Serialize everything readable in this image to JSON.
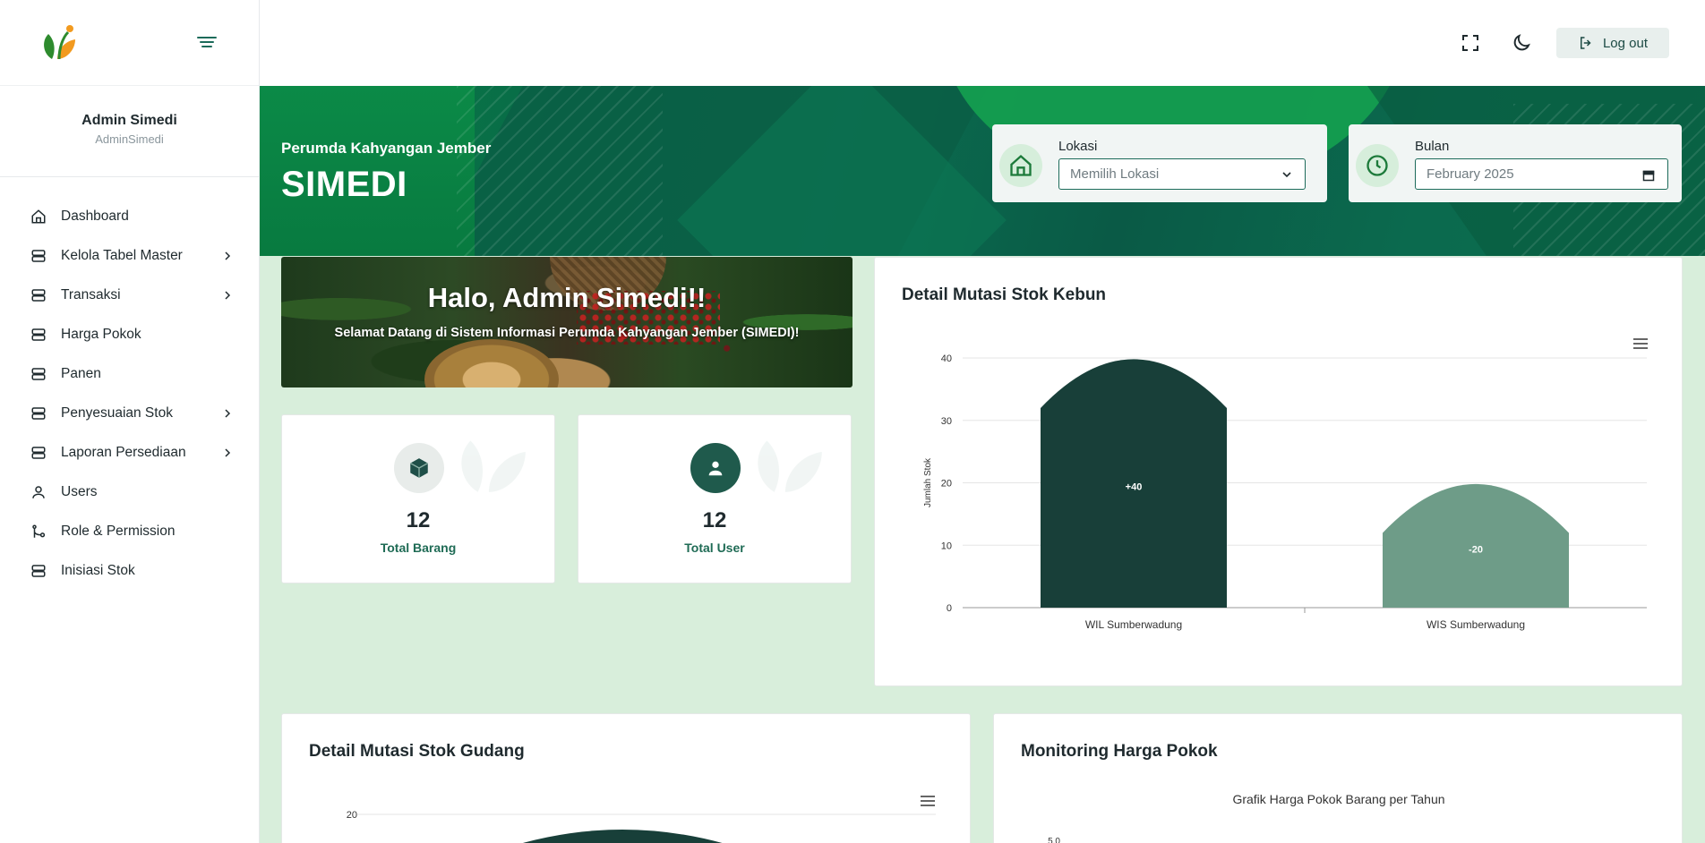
{
  "sidebar": {
    "profile": {
      "name": "Admin Simedi",
      "username": "AdminSimedi"
    },
    "items": [
      {
        "label": "Dashboard",
        "icon": "home-icon",
        "has_children": false
      },
      {
        "label": "Kelola Tabel Master",
        "icon": "server-icon",
        "has_children": true
      },
      {
        "label": "Transaksi",
        "icon": "server-icon",
        "has_children": true
      },
      {
        "label": "Harga Pokok",
        "icon": "server-icon",
        "has_children": false
      },
      {
        "label": "Panen",
        "icon": "server-icon",
        "has_children": false
      },
      {
        "label": "Penyesuaian Stok",
        "icon": "server-icon",
        "has_children": true
      },
      {
        "label": "Laporan Persediaan",
        "icon": "server-icon",
        "has_children": true
      },
      {
        "label": "Users",
        "icon": "user-icon",
        "has_children": false
      },
      {
        "label": "Role & Permission",
        "icon": "git-branch-icon",
        "has_children": false
      },
      {
        "label": "Inisiasi Stok",
        "icon": "server-icon",
        "has_children": false
      }
    ]
  },
  "topbar": {
    "logout_label": "Log out"
  },
  "hero": {
    "subtitle": "Perumda Kahyangan Jember",
    "title": "SIMEDI",
    "lokasi": {
      "label": "Lokasi",
      "value": "Memilih Lokasi"
    },
    "bulan": {
      "label": "Bulan",
      "value": "February 2025"
    }
  },
  "welcome": {
    "title": "Halo, Admin Simedi!!",
    "text": "Selamat Datang di Sistem Informasi Perumda Kahyangan Jember (SIMEDI)!"
  },
  "stats": [
    {
      "value": "12",
      "label": "Total Barang",
      "icon": "box-icon"
    },
    {
      "value": "12",
      "label": "Total User",
      "icon": "user-icon"
    }
  ],
  "cards": {
    "kebun_title": "Detail Mutasi Stok Kebun",
    "gudang_title": "Detail Mutasi Stok Gudang",
    "harga_title": "Monitoring Harga Pokok"
  },
  "colors": {
    "primary": "#1c6b5a",
    "bar_dark": "#183f39",
    "bar_light": "#6e9c88",
    "page_bg": "#d8eedb"
  },
  "chart_data": [
    {
      "type": "bar",
      "title": "",
      "categories": [
        "WIL Sumberwadung",
        "WIS Sumberwadung"
      ],
      "values": [
        40,
        20
      ],
      "data_labels": [
        "+40",
        "-20"
      ],
      "ylabel": "Jumlah Stok",
      "xlabel": "",
      "ylim": [
        0,
        40
      ],
      "yticks": [
        0,
        10,
        20,
        30,
        40
      ],
      "grid": true
    },
    {
      "type": "bar",
      "title": "",
      "categories": [],
      "values": [
        20
      ],
      "ylim": [
        0,
        20
      ],
      "yticks": [
        20
      ],
      "grid": true
    },
    {
      "type": "line",
      "title": "Grafik Harga Pokok Barang per Tahun",
      "ylim": [
        0,
        5.0
      ],
      "yticks": [
        5.0
      ]
    }
  ]
}
